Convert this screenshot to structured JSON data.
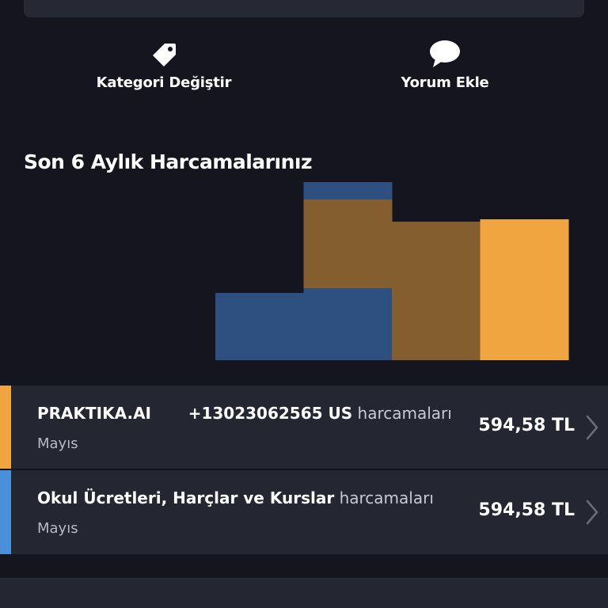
{
  "actions": {
    "change_category": {
      "label": "Kategori Değiştir",
      "icon": "tag-icon"
    },
    "add_comment": {
      "label": "Yorum Ekle",
      "icon": "speech-bubble-icon"
    }
  },
  "section_title": "Son 6 Aylık Harcamalarınız",
  "colors": {
    "background": "#15151f",
    "card": "#242631",
    "orange": "#f0a540",
    "brown": "#855e2f",
    "blue": "#2d5081",
    "stripe_blue": "#4a90d9"
  },
  "chart_data": {
    "type": "bar",
    "stacked": true,
    "categories": [
      "",
      "",
      "",
      ""
    ],
    "series": [
      {
        "color": "#2d5081",
        "values": [
          0,
          85,
          0,
          0
        ]
      },
      {
        "color": "#855e2f",
        "values": [
          0,
          112,
          175,
          0
        ]
      },
      {
        "color": "#f0a540",
        "values": [
          0,
          0,
          0,
          178
        ]
      },
      {
        "color": "#2d5081",
        "values": [
          85,
          91,
          0,
          0
        ]
      }
    ],
    "ylim": [
      0,
      205
    ]
  },
  "transactions": [
    {
      "merchant": "PRAKTIKA.AI",
      "phone": "+13023062565 US",
      "suffix": "harcamaları",
      "month": "Mayıs",
      "amount": "594,58 TL",
      "stripe_color": "#f0a540"
    },
    {
      "merchant": "Okul Ücretleri, Harçlar ve Kurslar",
      "phone": "",
      "suffix": "harcamaları",
      "month": "Mayıs",
      "amount": "594,58 TL",
      "stripe_color": "#4a90d9"
    }
  ]
}
